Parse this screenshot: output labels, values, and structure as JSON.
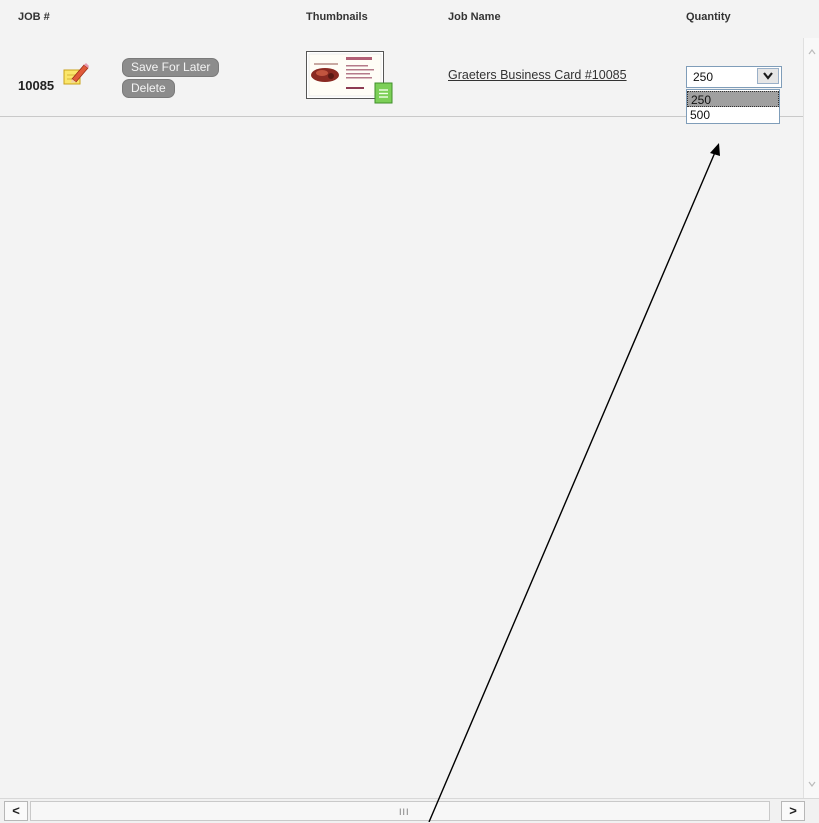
{
  "header": {
    "col_job": "JOB #",
    "col_thumbnails": "Thumbnails",
    "col_jobname": "Job Name",
    "col_quantity": "Quantity"
  },
  "row": {
    "job_number": "10085",
    "save_label": "Save For Later",
    "delete_label": "Delete",
    "job_name": "Graeters Business Card #10085",
    "quantity_selected": "250",
    "quantity_options": [
      "250",
      "500"
    ]
  },
  "scrollbar": {
    "left_arrow": "<",
    "right_arrow": ">",
    "grip": "III"
  },
  "icons": {
    "note": "edit-note-icon",
    "thumbnail": "business-card-thumbnail",
    "proof": "document-icon"
  }
}
